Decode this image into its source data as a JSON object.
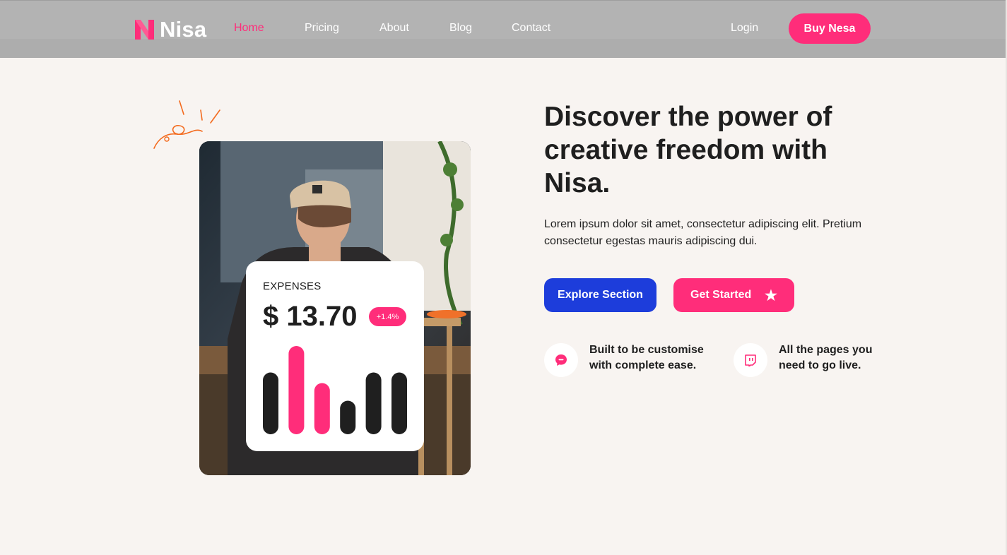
{
  "brand": {
    "name": "Nisa",
    "accent": "#ff2d7a",
    "blue": "#1d3ddb"
  },
  "nav": {
    "items": [
      {
        "label": "Home",
        "active": true
      },
      {
        "label": "Pricing",
        "active": false
      },
      {
        "label": "About",
        "active": false
      },
      {
        "label": "Blog",
        "active": false
      },
      {
        "label": "Contact",
        "active": false
      }
    ],
    "login_label": "Login",
    "buy_label": "Buy Nesa"
  },
  "hero": {
    "title": "Discover the power of creative freedom with Nisa.",
    "description": "Lorem ipsum dolor sit amet, consectetur adipiscing elit. Pretium consectetur egestas mauris adipiscing dui.",
    "explore_label": "Explore Section",
    "start_label": "Get Started",
    "start_icon": "star-icon"
  },
  "card": {
    "label": "EXPENSES",
    "amount": "$ 13.70",
    "badge": "+1.4%",
    "bars": [
      {
        "value": 0.7,
        "color": "#1f1f1f"
      },
      {
        "value": 1.0,
        "color": "#ff2d7a"
      },
      {
        "value": 0.58,
        "color": "#ff2d7a"
      },
      {
        "value": 0.38,
        "color": "#1f1f1f"
      },
      {
        "value": 0.7,
        "color": "#1f1f1f"
      },
      {
        "value": 0.7,
        "color": "#1f1f1f"
      }
    ]
  },
  "features": [
    {
      "text": "Built to be customise with complete ease.",
      "icon": "chat-bubble-icon"
    },
    {
      "text": "All the pages you need to go live.",
      "icon": "twitch-icon"
    }
  ]
}
